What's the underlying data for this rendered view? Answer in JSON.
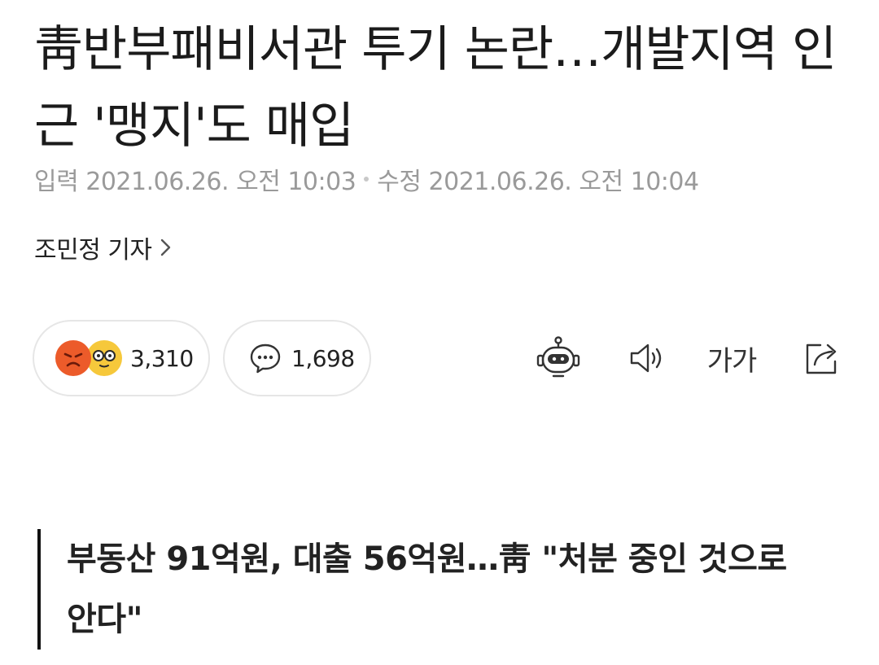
{
  "article": {
    "headline": "靑반부패비서관 투기 논란…개발지역 인근 '맹지'도 매입",
    "meta": {
      "input_label": "입력",
      "input_time": "2021.06.26. 오전 10:03",
      "edit_label": "수정",
      "edit_time": "2021.06.26. 오전 10:04"
    },
    "reporter": "조민정 기자",
    "subheading": "부동산 91억원, 대출 56억원…靑 \"처분 중인 것으로 안다\""
  },
  "actions": {
    "reactions_count": "3,310",
    "comments_count": "1,698",
    "font_size_label": "가가"
  },
  "icons": {
    "reporter_chevron": "chevron-right-icon",
    "reaction_angry": "angry-emoji-icon",
    "reaction_nerd": "nerd-emoji-icon",
    "comment": "comment-bubble-icon",
    "summary_bot": "robot-icon",
    "read_aloud": "speaker-icon",
    "font_size": "font-size-icon",
    "share": "share-icon"
  },
  "colors": {
    "angry": "#ec5b2a",
    "nerd": "#f6c83b",
    "meta_text": "#9a9a9a",
    "border": "#e6e6e6"
  }
}
